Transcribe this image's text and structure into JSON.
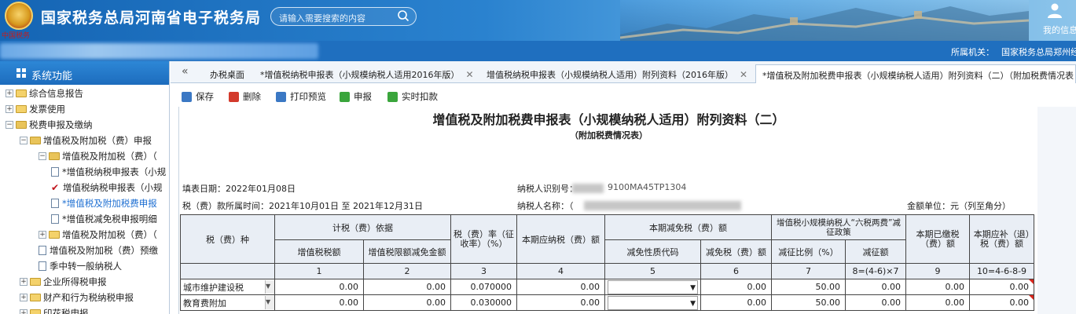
{
  "header": {
    "site_title": "国家税务总局河南省电子税务局",
    "emblem_caption": "中国税务",
    "search_placeholder": "请输入需要搜索的内容",
    "user_label": "我的信息"
  },
  "subbar": {
    "org_label": "所属机关：",
    "org_value": "国家税务总局郑州经"
  },
  "sidebar": {
    "title": "系统功能",
    "items": [
      {
        "label": "综合信息报告"
      },
      {
        "label": "发票使用"
      },
      {
        "label": "税费申报及缴纳"
      },
      {
        "label": "增值税及附加税（费）申报"
      },
      {
        "label": "增值税及附加税（费）（"
      },
      {
        "label": "*增值税纳税申报表（小规"
      },
      {
        "label": "增值税纳税申报表（小规"
      },
      {
        "label": "*增值税及附加税费申报"
      },
      {
        "label": "*增值税减免税申报明细"
      },
      {
        "label": "增值税及附加税（费）（"
      },
      {
        "label": "增值税及附加税（费）预缴"
      },
      {
        "label": "季中转一般纳税人"
      },
      {
        "label": "企业所得税申报"
      },
      {
        "label": "财产和行为税纳税申报"
      },
      {
        "label": "印花税申报"
      }
    ]
  },
  "tabs": [
    {
      "label": "办税桌面"
    },
    {
      "label": "*增值税纳税申报表（小规模纳税人适用2016年版）"
    },
    {
      "label": "增值税纳税申报表（小规模纳税人适用）附列资料（2016年版）"
    },
    {
      "label": "*增值税及附加税费申报表（小规模纳税人适用）附列资料（二）（附加税费情况表"
    }
  ],
  "toolbar": {
    "save": "保存",
    "delete": "删除",
    "print_preview": "打印预览",
    "declare": "申报",
    "realtime_deduct": "实时扣款"
  },
  "form": {
    "title": "增值税及附加税费申报表（小规模纳税人适用）附列资料（二）",
    "subtitle": "（附加税费情况表）",
    "fill_date": "填表日期：2022年01月08日",
    "period": "税（费）款所属时间：2021年10月01日 至 2021年12月31日",
    "taxpayer_id_label": "纳税人识别号：",
    "taxpayer_id_tail": "9100MA45TP1304",
    "taxpayer_name_label": "纳税人名称：（",
    "amount_unit": "金额单位：元（列至角分）"
  },
  "table": {
    "h_tax_type": "税（费）种",
    "h_basis": "计税（费）依据",
    "h_vat_amount": "增值税税额",
    "h_vat_limit": "增值税限额减免金额",
    "h_rate": "税（费）率（征收率）（%）",
    "h_payable": "本期应纳税（费）额",
    "h_reduction": "本期减免税（费）额",
    "h_reduction_code": "减免性质代码",
    "h_reduction_amount": "减免税（费）额",
    "h_six_tax": "增值税小规模纳税人“六税两费”减征政策",
    "h_ratio": "减征比例（%）",
    "h_reduced": "减征额",
    "h_paid": "本期已缴税（费）额",
    "h_refund": "本期应补（退）税（费）额",
    "col_nums": [
      "1",
      "2",
      "3",
      "4",
      "5",
      "6",
      "7",
      "8=(4-6)×7",
      "9",
      "10=4-6-8-9"
    ],
    "rows": [
      {
        "name": "城市维护建设税",
        "c1": "0.00",
        "c2": "0.00",
        "c3": "0.070000",
        "c4": "0.00",
        "c6": "0.00",
        "c7": "50.00",
        "c8": "0.00",
        "c9": "0.00",
        "c10": "0.00"
      },
      {
        "name": "教育费附加",
        "c1": "0.00",
        "c2": "0.00",
        "c3": "0.030000",
        "c4": "0.00",
        "c6": "0.00",
        "c7": "50.00",
        "c8": "0.00",
        "c9": "0.00",
        "c10": "0.00"
      }
    ]
  }
}
